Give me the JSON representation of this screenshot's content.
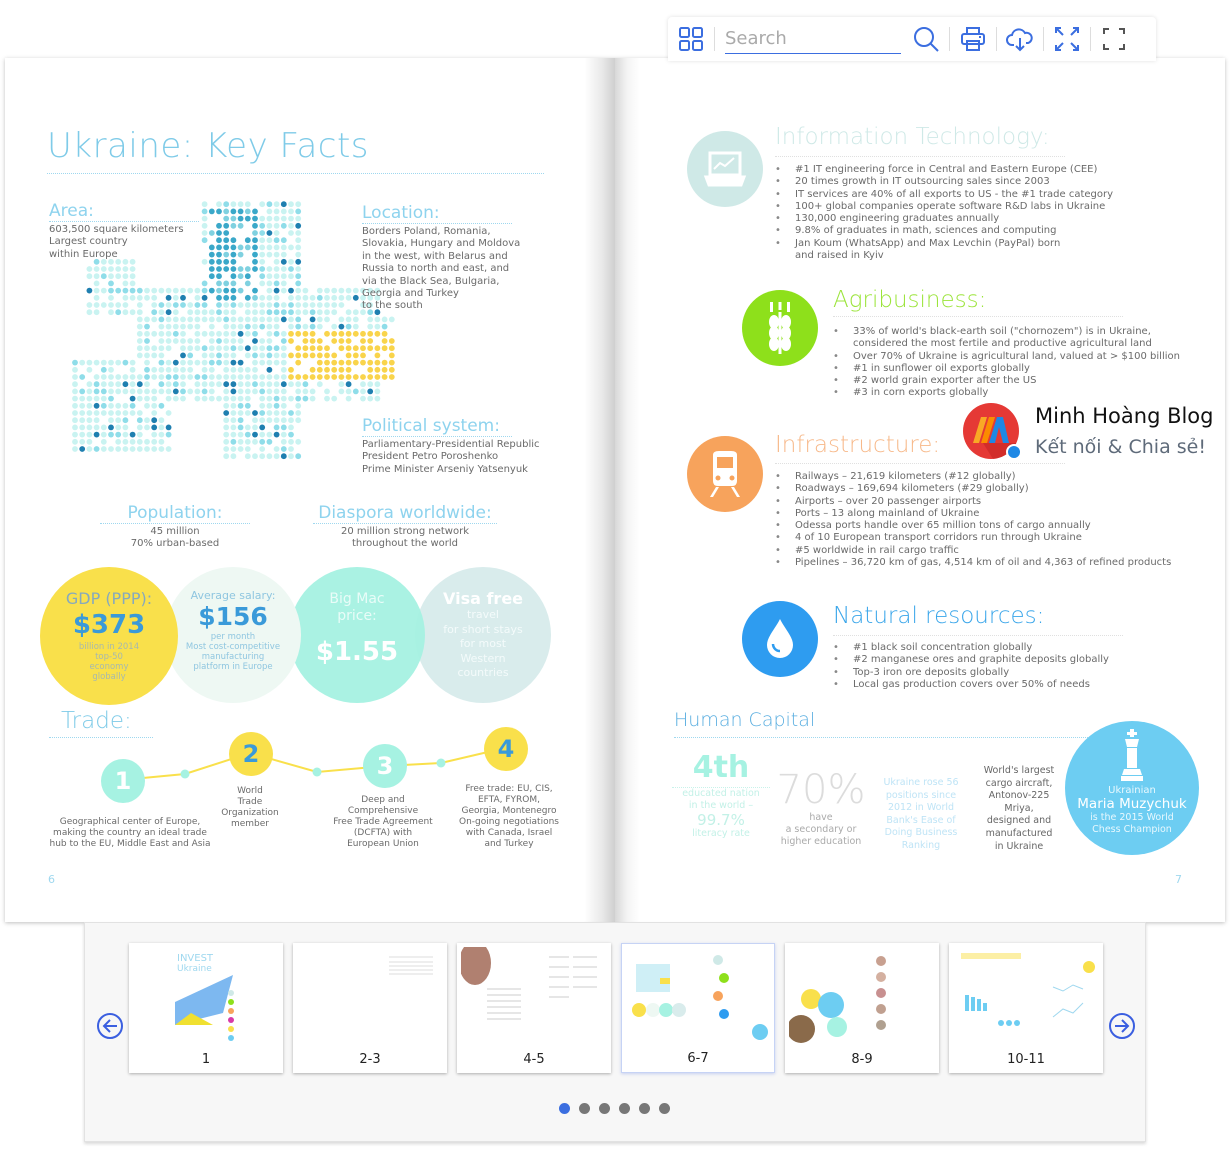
{
  "toolbar": {
    "search_placeholder": "Search",
    "icons": [
      "grid-icon",
      "search-icon",
      "print-icon",
      "cloud-download-icon",
      "shrink-icon",
      "fullscreen-icon"
    ]
  },
  "left_page": {
    "title": "Ukraine: Key Facts",
    "area": {
      "heading": "Area:",
      "lines": [
        "603,500 square kilometers",
        "Largest country",
        "within Europe"
      ]
    },
    "location": {
      "heading": "Location:",
      "lines": [
        "Borders Poland, Romania,",
        "Slovakia, Hungary and Moldova",
        "in the west, with Belarus and",
        "Russia to north and east, and",
        "via the Black Sea, Bulgaria,",
        "Georgia and Turkey",
        "to the south"
      ]
    },
    "political": {
      "heading": "Political system:",
      "lines": [
        "Parliamentary-Presidential Republic",
        "President Petro Poroshenko",
        "Prime Minister Arseniy Yatsenyuk"
      ]
    },
    "population": {
      "heading": "Population:",
      "lines": [
        "45 million",
        "70% urban-based"
      ]
    },
    "diaspora": {
      "heading": "Diaspora worldwide:",
      "lines": [
        "20 million strong network",
        "throughout the world"
      ]
    },
    "gdp": {
      "heading": "GDP (PPP):",
      "value": "$373",
      "lines": [
        "billion in 2014",
        "top-50",
        "economy",
        "globally"
      ]
    },
    "salary": {
      "heading": "Average salary:",
      "value": "$156",
      "lines": [
        "per month",
        "Most cost-competitive",
        "manufacturing",
        "platform in Europe"
      ]
    },
    "bigmac": {
      "heading_1": "Big Mac",
      "heading_2": "price:",
      "value": "$1.55"
    },
    "visa": {
      "heading": "Visa free",
      "lines": [
        "travel",
        "for short stays",
        "for most",
        "Western",
        "countries"
      ]
    },
    "trade": {
      "heading": "Trade:",
      "steps": [
        {
          "num": "1",
          "lines": [
            "Geographical center of Europe,",
            "making the country an ideal trade",
            "hub to the EU, Middle East and Asia"
          ]
        },
        {
          "num": "2",
          "lines": [
            "World",
            "Trade",
            "Organization",
            "member"
          ]
        },
        {
          "num": "3",
          "lines": [
            "Deep and",
            "Comprehensive",
            "Free Trade Agreement",
            "(DCFTA) with",
            "European Union"
          ]
        },
        {
          "num": "4",
          "lines": [
            "Free trade: EU, CIS,",
            "EFTA, FYROM,",
            "Georgia, Montenegro",
            "On-going negotiations",
            "with Canada, Israel",
            "and Turkey"
          ]
        }
      ]
    },
    "page_number": "6"
  },
  "right_page": {
    "it": {
      "heading": "Information Technology:",
      "bullets": [
        "#1 IT engineering force in Central and Eastern Europe (CEE)",
        "20 times growth in IT outsourcing sales since 2003",
        "IT services are 40% of all exports to US - the #1 trade category",
        "100+ global companies operate software R&D labs in Ukraine",
        "130,000 engineering graduates annually",
        "9.8% of graduates in math, sciences and computing",
        "Jan Koum (WhatsApp) and Max Levchin (PayPal) born and raised in Kyiv"
      ]
    },
    "agri": {
      "heading": "Agribusiness:",
      "bullets": [
        "33% of world's black-earth soil (\"chornozem\") is in Ukraine, considered the most fertile and productive agricultural land",
        "Over 70% of Ukraine is agricultural land, valued at > $100 billion",
        "#1 in sunflower oil exports globally",
        "#2 world grain exporter after the US",
        "#3 in corn exports globally"
      ]
    },
    "infra": {
      "heading": "Infrastructure:",
      "bullets": [
        "Railways – 21,619 kilometers (#12 globally)",
        "Roadways – 169,694 kilometers (#29 globally)",
        "Airports – over 20 passenger airports",
        "Ports – 13 along mainland of Ukraine",
        "Odessa ports handle over 65 million tons of cargo annually",
        "4 of 10 European transport corridors run through Ukraine",
        "#5 worldwide in rail cargo traffic",
        "Pipelines – 36,720 km of gas, 4,514 km of oil and 4,363 of refined products"
      ]
    },
    "natural": {
      "heading": "Natural resources:",
      "bullets": [
        "#1 black soil concentration globally",
        "#2 manganese ores and graphite deposits globally",
        "Top-3 iron ore deposits globally",
        "Local gas production covers over 50% of needs"
      ]
    },
    "human": {
      "heading": "Human Capital",
      "rank": {
        "value": "4th",
        "lines": [
          "educated nation",
          "in the world –"
        ],
        "pct": "99.7%",
        "tail": "literacy rate"
      },
      "edu": {
        "value": "70%",
        "lines": [
          "have",
          "a secondary or",
          "higher education"
        ]
      },
      "biz": {
        "lines": [
          "Ukraine rose 56",
          "positions since",
          "2012 in World",
          "Bank's Ease of",
          "Doing Business",
          "Ranking"
        ]
      },
      "aircraft": {
        "lines": [
          "World's largest",
          "cargo aircraft,",
          "Antonov-225",
          "Mriya,",
          "designed and",
          "manufactured",
          "in Ukraine"
        ]
      },
      "chess": {
        "pre": "Ukrainian",
        "name": "Maria Muzychuk",
        "lines": [
          "is the 2015 World",
          "Chess Champion"
        ]
      }
    },
    "page_number": "7"
  },
  "blog_badge": {
    "name": "Minh Hoàng Blog",
    "tagline": "Kết nối & Chia sẻ!"
  },
  "thumbnails": [
    {
      "label": "1",
      "active": false
    },
    {
      "label": "2-3",
      "active": false
    },
    {
      "label": "4-5",
      "active": false
    },
    {
      "label": "6-7",
      "active": true
    },
    {
      "label": "8-9",
      "active": false
    },
    {
      "label": "10-11",
      "active": false
    }
  ],
  "pagination": {
    "count": 6,
    "active_index": 0
  },
  "colors": {
    "accent": "#3b6ee0",
    "title_blue": "#7fcbe8",
    "yellow": "#f9e04b",
    "mint": "#a6f2e2",
    "green": "#8ee01b",
    "orange": "#f7a35c",
    "water_blue": "#2e9cf0",
    "chess_blue": "#6dcdf2"
  }
}
